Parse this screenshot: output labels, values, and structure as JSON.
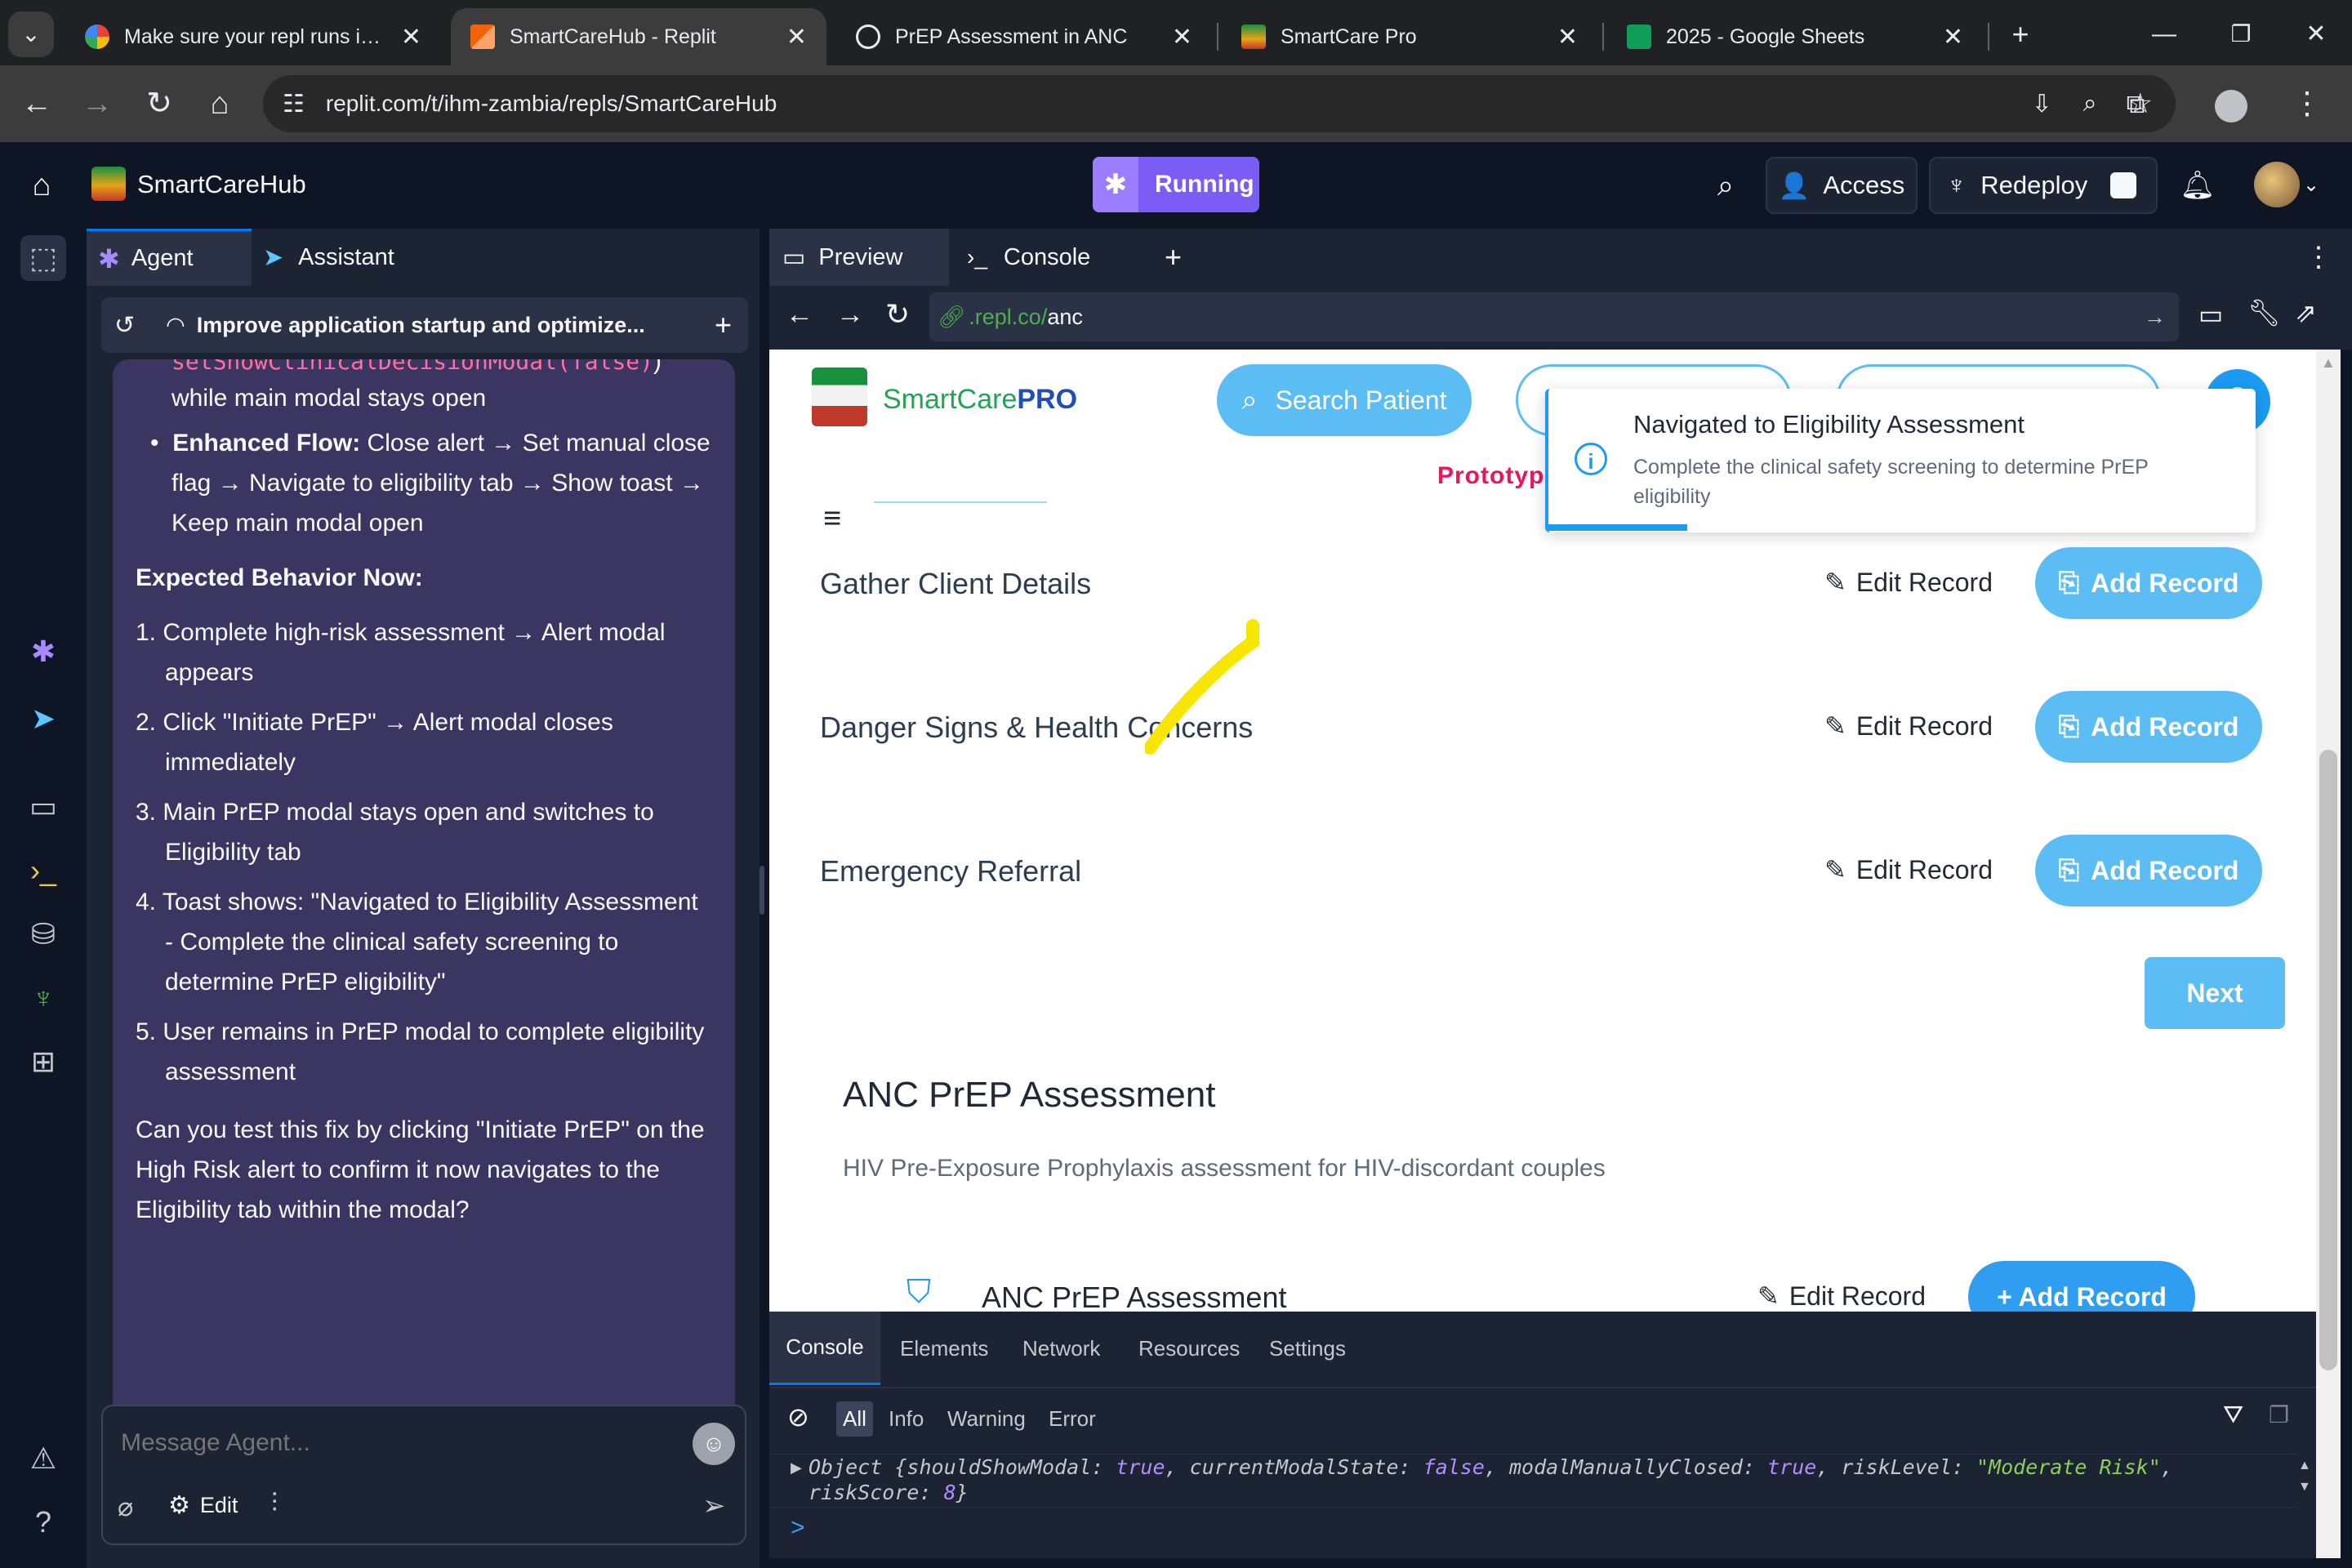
{
  "browser": {
    "tabs": [
      {
        "title": "Make sure your repl runs in the",
        "icon": "google-icon"
      },
      {
        "title": "SmartCareHub - Replit",
        "icon": "replit-icon",
        "active": true
      },
      {
        "title": "PrEP Assessment in ANC",
        "icon": "openai-icon"
      },
      {
        "title": "SmartCare Pro",
        "icon": "coat-of-arms-icon"
      },
      {
        "title": "2025 - Google Sheets",
        "icon": "sheets-icon"
      }
    ],
    "url": "replit.com/t/ihm-zambia/repls/SmartCareHub"
  },
  "replit": {
    "repl_name": "SmartCareHub",
    "status": "Running",
    "access_label": "Access",
    "redeploy_label": "Redeploy"
  },
  "agent_panel": {
    "tabs": {
      "agent": "Agent",
      "assistant": "Assistant"
    },
    "thread_title": "Improve application startup and optimize...",
    "chat": {
      "code_line": "setShowClinicalDecisionModal(false)",
      "code_suffix": ")",
      "line_after_code": "while main modal stays open",
      "enhanced_flow_label": "Enhanced Flow:",
      "enhanced_flow_text": "Close alert → Set manual close flag → Navigate to eligibility tab → Show toast → Keep main modal open",
      "expected_heading": "Expected Behavior Now:",
      "steps": [
        "Complete high-risk assessment → Alert modal appears",
        "Click \"Initiate PrEP\" → Alert modal closes immediately",
        "Main PrEP modal stays open and switches to Eligibility tab",
        "Toast shows: \"Navigated to Eligibility Assessment - Complete the clinical safety screening to determine PrEP eligibility\"",
        "User remains in PrEP modal to complete eligibility assessment"
      ],
      "closing": "Can you test this fix by clicking \"Initiate PrEP\" on the High Risk alert to confirm it now navigates to the Eligibility tab within the modal?"
    },
    "message_placeholder": "Message Agent...",
    "edit_label": "Edit"
  },
  "preview": {
    "tabs": {
      "preview": "Preview",
      "console": "Console"
    },
    "url_prefix": ".repl.co/",
    "url_path": "anc",
    "app": {
      "brand_plain": "SmartCare",
      "brand_bold": "PRO",
      "search_label": "Search Patient",
      "prototype_label": "Prototyp",
      "toast": {
        "title": "Navigated to Eligibility Assessment",
        "body": "Complete the clinical safety screening to determine PrEP eligibility"
      },
      "sections": [
        {
          "title": "Gather Client Details",
          "edit": "Edit Record",
          "add": "Add Record"
        },
        {
          "title": "Danger Signs & Health Concerns",
          "edit": "Edit Record",
          "add": "Add Record"
        },
        {
          "title": "Emergency Referral",
          "edit": "Edit Record",
          "add": "Add Record"
        }
      ],
      "next_label": "Next",
      "assessment": {
        "heading": "ANC PrEP Assessment",
        "subtitle": "HIV Pre-Exposure Prophylaxis assessment for HIV-discordant couples",
        "row_title": "ANC PrEP Assessment",
        "edit": "Edit Record",
        "add": "+ Add Record"
      }
    }
  },
  "devtools": {
    "tabs": [
      "Console",
      "Elements",
      "Network",
      "Resources",
      "Settings"
    ],
    "levels": [
      "All",
      "Info",
      "Warning",
      "Error"
    ],
    "log": {
      "prefix": "Object {",
      "pairs": [
        {
          "key": "shouldShowModal",
          "val": "true",
          "sep": ", "
        },
        {
          "key": "currentModalState",
          "val": "false",
          "sep": ", "
        },
        {
          "key": "modalManuallyClosed",
          "val": "true",
          "sep": ", "
        },
        {
          "key": "riskLevel",
          "val": "\"Moderate Risk\"",
          "sep": ", "
        },
        {
          "key": "riskScore",
          "val": "8",
          "sep": "}"
        }
      ]
    },
    "prompt": ">"
  },
  "colors": {
    "replit_bg": "#0e1525",
    "panel_bg": "#1c2333",
    "chat_bubble": "#3b3562",
    "accent_purple": "#7b5cf5",
    "app_blue": "#5cbdf5",
    "brand_green": "#23a455",
    "prototype_pink": "#e8175d"
  }
}
